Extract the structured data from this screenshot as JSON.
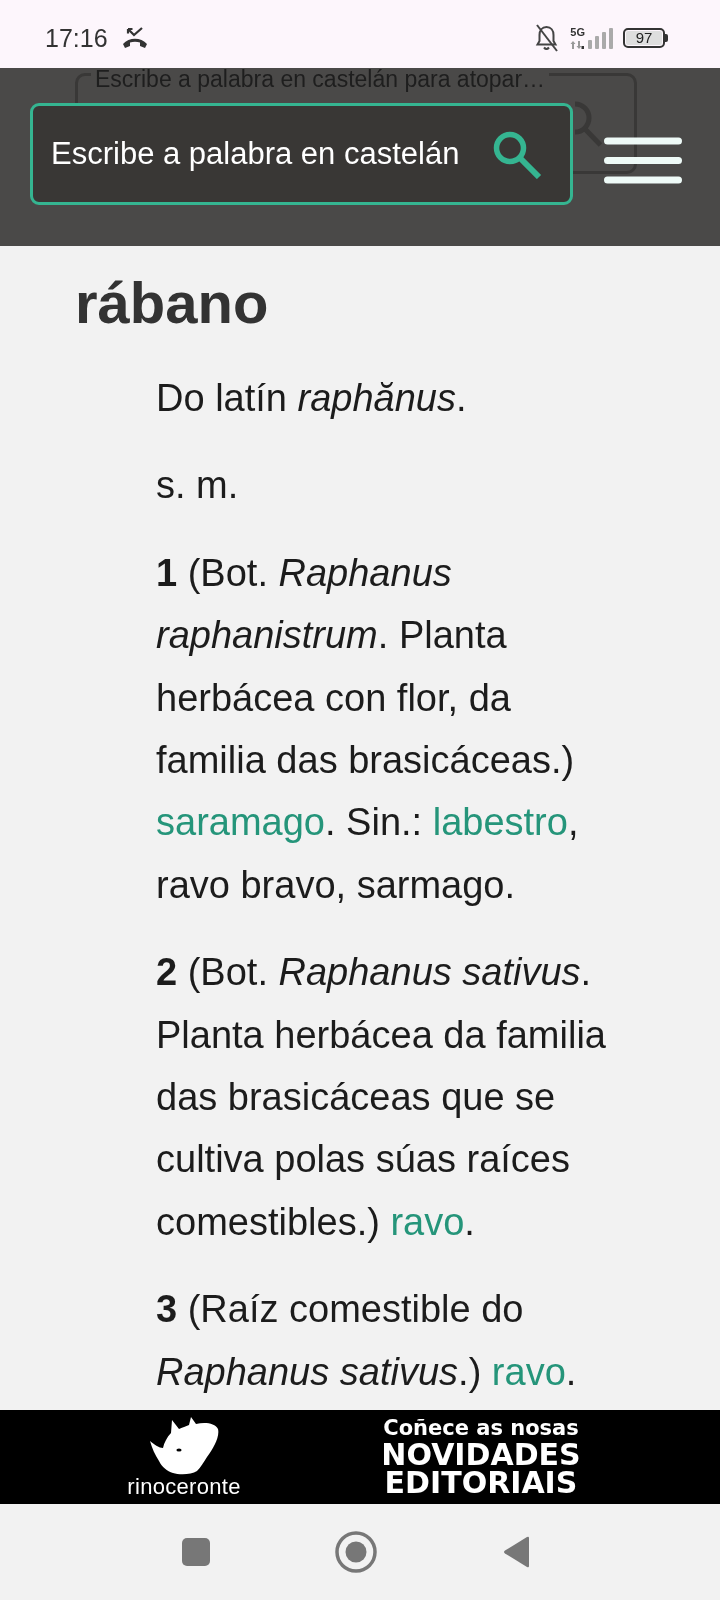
{
  "status_bar": {
    "time": "17:16",
    "network": "5G",
    "battery": "97"
  },
  "header": {
    "faded_search": {
      "placeholder": "Escribe a palabra en castelán para atopar…"
    },
    "search": {
      "placeholder": "Escribe a palabra en castelán"
    }
  },
  "entry": {
    "headword": "rábano",
    "etymology": "Do latín *raphănus*.",
    "grammar": "s. m.",
    "senses": [
      {
        "number": "1",
        "parts": [
          {
            "kind": "text",
            "text": "(Bot. *Raphanus raphanistrum*. Planta herbácea con flor, da familia das brasicáceas.) "
          },
          {
            "kind": "link",
            "text": "saramago"
          },
          {
            "kind": "text",
            "text": ". Sin.: "
          },
          {
            "kind": "link",
            "text": "labestro"
          },
          {
            "kind": "text",
            "text": ", ravo bravo, sarmago."
          }
        ]
      },
      {
        "number": "2",
        "parts": [
          {
            "kind": "text",
            "text": "(Bot. *Raphanus sativus*. Planta herbácea da familia das brasicáceas que se cultiva polas súas raíces comestibles.) "
          },
          {
            "kind": "link",
            "text": "ravo"
          },
          {
            "kind": "text",
            "text": "."
          }
        ]
      },
      {
        "number": "3",
        "parts": [
          {
            "kind": "text",
            "text": "(Raíz comestible do *Raphanus sativus*.) "
          },
          {
            "kind": "link",
            "text": "ravo"
          },
          {
            "kind": "text",
            "text": "."
          }
        ]
      }
    ]
  },
  "banner": {
    "brand": "rinoceronte",
    "lead": "Coñece as nosas",
    "title": "NOVIDADES EDITORIAIS"
  }
}
